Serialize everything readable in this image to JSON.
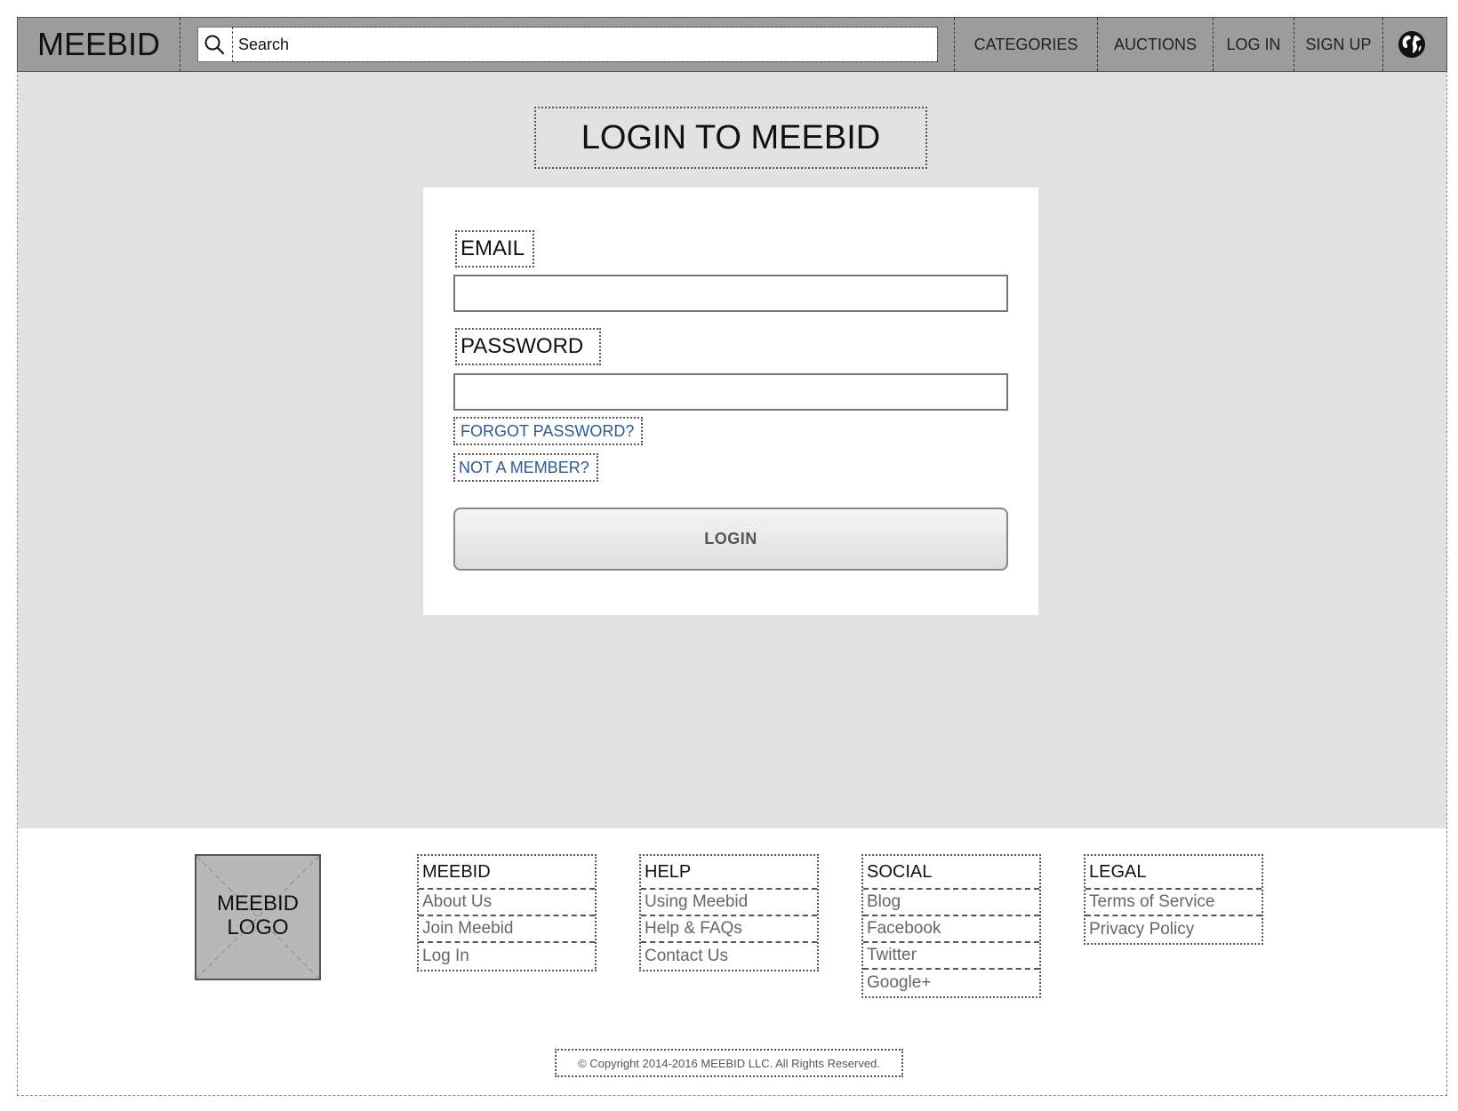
{
  "header": {
    "brand": "MEEBID",
    "search": {
      "placeholder": "Search",
      "value": ""
    },
    "nav": {
      "categories": "CATEGORIES",
      "auctions": "AUCTIONS",
      "login": "LOG IN",
      "signup": "SIGN UP"
    },
    "icons": {
      "search": "search-icon",
      "language": "globe-icon"
    }
  },
  "main": {
    "title": "LOGIN TO MEEBID",
    "form": {
      "email_label": "EMAIL",
      "email_value": "",
      "password_label": "PASSWORD",
      "password_value": "",
      "forgot_password": "FORGOT PASSWORD?",
      "not_member": "NOT A MEMBER?",
      "submit": "LOGIN"
    }
  },
  "footer": {
    "logo_text": "MEEBID\nLOGO",
    "columns": [
      {
        "heading": "MEEBID",
        "links": [
          "About Us",
          "Join Meebid",
          "Log In"
        ]
      },
      {
        "heading": "HELP",
        "links": [
          "Using Meebid",
          "Help & FAQs",
          "Contact Us"
        ]
      },
      {
        "heading": "SOCIAL",
        "links": [
          "Blog",
          "Facebook",
          "Twitter",
          "Google+"
        ]
      },
      {
        "heading": "LEGAL",
        "links": [
          "Terms of Service",
          "Privacy Policy"
        ]
      }
    ],
    "copyright": "© Copyright 2014-2016 MEEBID LLC. All Rights Reserved."
  },
  "colors": {
    "header_bg": "#9c9c9c",
    "main_bg": "#e2e2e2",
    "link": "#2a5a9a",
    "footer_link": "#666666"
  }
}
